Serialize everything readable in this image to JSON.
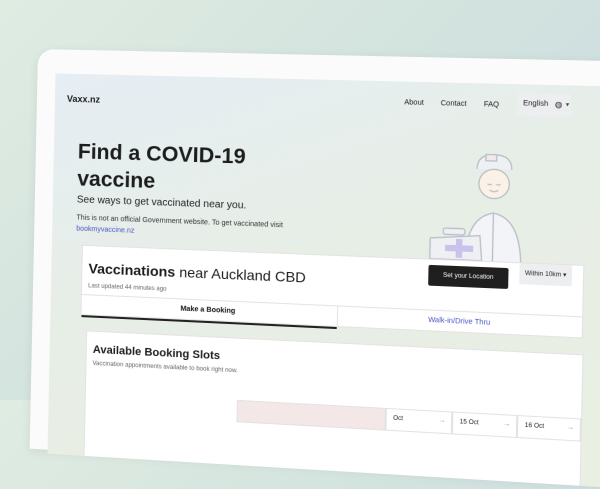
{
  "nav": {
    "logo": "Vaxx.nz",
    "links": [
      "About",
      "Contact",
      "FAQ"
    ],
    "language": "English"
  },
  "hero": {
    "title": "Find a COVID-19 vaccine",
    "subtitle": "See ways to get vaccinated near you.",
    "note": "This is not an official Government website. To get vaccinated visit",
    "link": "bookmyvaccine.nz"
  },
  "vaccinations": {
    "title_bold": "Vaccinations",
    "title_rest": " near Auckland CBD",
    "updated": "Last updated 44 minutes ago",
    "set_location": "Set your Location",
    "within": "Within 10km",
    "tabs": [
      "Make a Booking",
      "Walk-in/Drive Thru"
    ]
  },
  "slots": {
    "title": "Available Booking Slots",
    "subtitle": "Vaccination appointments available to book right now.",
    "dates": [
      "",
      "Oct",
      "15 Oct",
      "16 Oct"
    ]
  },
  "colors": {
    "accent": "#4a56c9",
    "dark_button": "#1f1f1f"
  }
}
